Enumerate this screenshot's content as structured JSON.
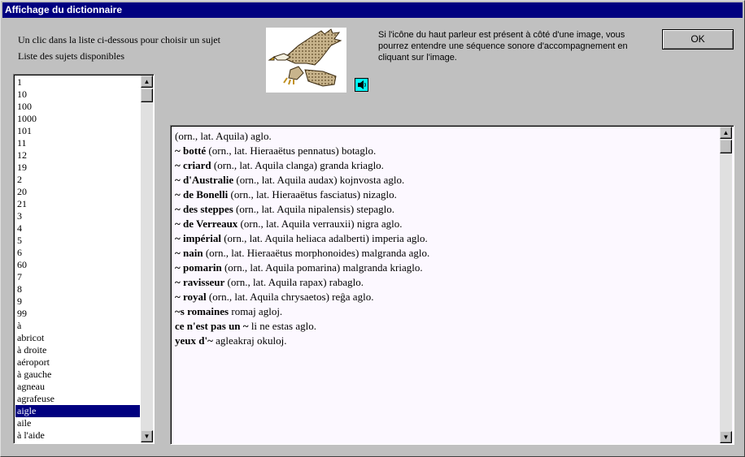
{
  "window": {
    "title": "Affichage du dictionnaire"
  },
  "instructions": {
    "choose_subject": "Un clic dans la liste ci-dessous pour choisir un sujet",
    "list_label": "Liste des sujets disponibles",
    "speaker_info": "Si l'icône du haut parleur est présent à côté d'une image, vous pourrez entendre une séquence sonore d'accompagnement en cliquant sur l'image."
  },
  "ok_button": "OK",
  "image": {
    "subject": "eagle",
    "icon": "speaker-icon"
  },
  "subjects": {
    "items": [
      "1",
      "10",
      "100",
      "1000",
      "101",
      "11",
      "12",
      "19",
      "2",
      "20",
      "21",
      "3",
      "4",
      "5",
      "6",
      "60",
      "7",
      "8",
      "9",
      "99",
      "à",
      "abricot",
      "à droite",
      "aéroport",
      "à gauche",
      "agneau",
      "agrafeuse",
      "aigle",
      "aile",
      "à l'aide"
    ],
    "selected": "aigle"
  },
  "entries": [
    {
      "head": "",
      "rest": "(orn., lat. Aquila) aglo."
    },
    {
      "head": "~ botté",
      "rest": " (orn., lat. Hieraaëtus pennatus) botaglo."
    },
    {
      "head": "~ criard",
      "rest": " (orn., lat. Aquila clanga) granda kriaglo."
    },
    {
      "head": "~ d'Australie",
      "rest": " (orn., lat. Aquila audax) kojnvosta aglo."
    },
    {
      "head": "~ de Bonelli",
      "rest": " (orn., lat. Hieraaëtus fasciatus) nizaglo."
    },
    {
      "head": "~ des steppes",
      "rest": " (orn., lat. Aquila nipalensis) stepaglo."
    },
    {
      "head": "~ de Verreaux",
      "rest": " (orn., lat. Aquila verrauxii) nigra aglo."
    },
    {
      "head": "~ impérial",
      "rest": " (orn., lat. Aquila heliaca adalberti) imperia aglo."
    },
    {
      "head": "~ nain",
      "rest": " (orn., lat. Hieraaëtus morphonoides) malgranda aglo."
    },
    {
      "head": "~ pomarin",
      "rest": " (orn., lat. Aquila pomarina) malgranda kriaglo."
    },
    {
      "head": "~ ravisseur",
      "rest": " (orn., lat. Aquila rapax) rabaglo."
    },
    {
      "head": "~ royal",
      "rest": " (orn., lat. Aquila chrysaetos) reĝa aglo."
    },
    {
      "head": "~s romaines",
      "rest": " romaj agloj."
    },
    {
      "head": "ce n'est pas un ~",
      "rest": " li ne estas aglo."
    },
    {
      "head": "yeux d'~",
      "rest": " agleakraj okuloj."
    }
  ],
  "colors": {
    "titlebar": "#000080",
    "selection": "#000080",
    "speaker_bg": "#00ffff",
    "text_area_bg": "#fcf8ff"
  }
}
